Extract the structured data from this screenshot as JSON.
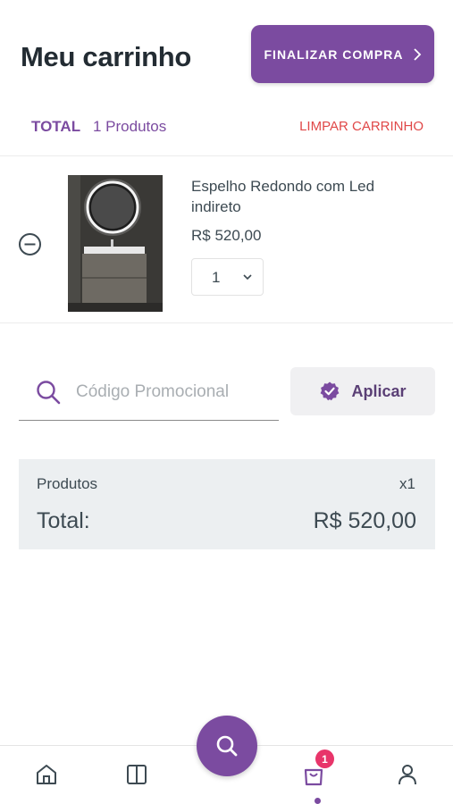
{
  "header": {
    "title": "Meu carrinho",
    "checkout_label": "FINALIZAR COMPRA"
  },
  "cart_summary": {
    "total_label": "TOTAL",
    "product_count": "1 Produtos",
    "clear_label": "LIMPAR CARRINHO"
  },
  "items": [
    {
      "name": "Espelho Redondo com Led indireto",
      "price": "R$ 520,00",
      "quantity": "1"
    }
  ],
  "promo": {
    "placeholder": "Código Promocional",
    "apply_label": "Aplicar"
  },
  "summary": {
    "products_label": "Produtos",
    "products_qty": "x1",
    "total_label": "Total:",
    "total_value": "R$ 520,00"
  },
  "nav": {
    "cart_badge": "1",
    "items": [
      "home-icon",
      "catalog-icon",
      "search-icon",
      "cart-icon",
      "account-icon"
    ],
    "active": "cart"
  },
  "colors": {
    "brand": "#7b4ba0",
    "danger": "#e04848",
    "badge": "#e8356a"
  }
}
